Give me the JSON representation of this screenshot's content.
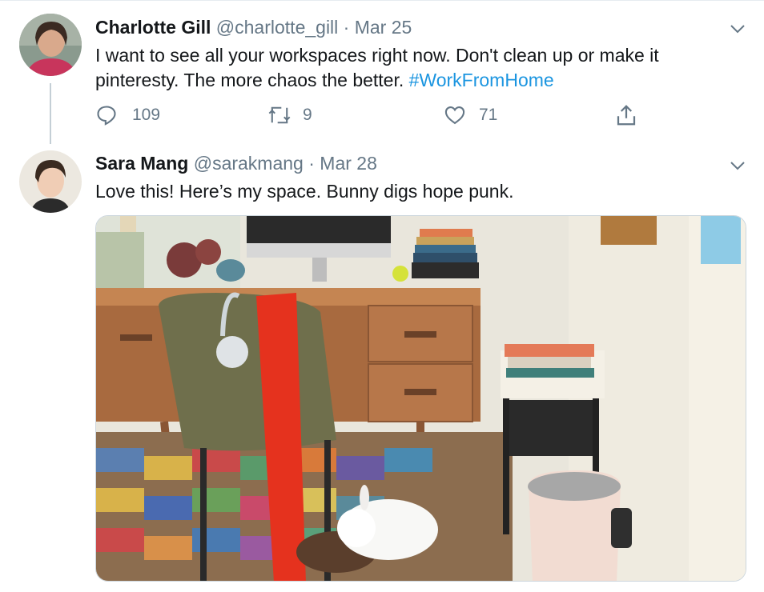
{
  "tweets": [
    {
      "name": "Charlotte Gill",
      "handle": "@charlotte_gill",
      "separator": "·",
      "date": "Mar 25",
      "text": "I want to see all your workspaces right now. Don't clean up or make it pinteresty. The more chaos the better. ",
      "hashtag": "#WorkFromHome",
      "actions": {
        "reply_count": "109",
        "retweet_count": "9",
        "like_count": "71"
      }
    },
    {
      "name": "Sara Mang",
      "handle": "@sarakmang",
      "separator": "·",
      "date": "Mar 28",
      "text": "Love this! Here’s my space. Bunny digs hope punk."
    }
  ],
  "colors": {
    "link": "#1b95e0",
    "secondary_text": "#657786",
    "thread_line": "#c4cfd6"
  },
  "icons": [
    "reply-icon",
    "retweet-icon",
    "like-icon",
    "share-icon",
    "chevron-down-icon"
  ]
}
